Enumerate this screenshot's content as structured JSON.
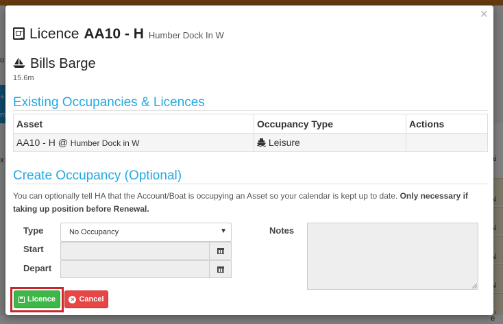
{
  "background": {
    "left_labels": [
      "u",
      "+",
      "m",
      "x"
    ],
    "right_labels": [
      "ai",
      "N",
      "N",
      "N",
      "N",
      "N"
    ],
    "bottom_right": "e"
  },
  "modal": {
    "close_label": "×",
    "title": {
      "icon": "licence-icon",
      "word": "Licence",
      "code": "AA10 - H",
      "location": "Humber Dock In W"
    },
    "boat": {
      "icon": "boat-icon",
      "name": "Bills Barge",
      "length": "15.6m"
    },
    "existing": {
      "heading": "Existing Occupancies & Licences",
      "columns": [
        "Asset",
        "Occupancy Type",
        "Actions"
      ],
      "rows": [
        {
          "asset_code": "AA10 - H @",
          "asset_location": "Humber Dock in W",
          "type_icon": "ship-icon",
          "type": "Leisure",
          "actions": ""
        }
      ]
    },
    "create": {
      "heading": "Create Occupancy (Optional)",
      "help_text": "You can optionally tell HA that the Account/Boat is occupying an Asset so your calendar is kept up to date.",
      "help_bold": "Only necessary if taking up position before Renewal.",
      "type_label": "Type",
      "type_value": "No Occupancy",
      "start_label": "Start",
      "start_value": "",
      "depart_label": "Depart",
      "depart_value": "",
      "notes_label": "Notes",
      "notes_value": ""
    },
    "buttons": {
      "licence_label": "Licence",
      "cancel_label": "Cancel"
    }
  }
}
